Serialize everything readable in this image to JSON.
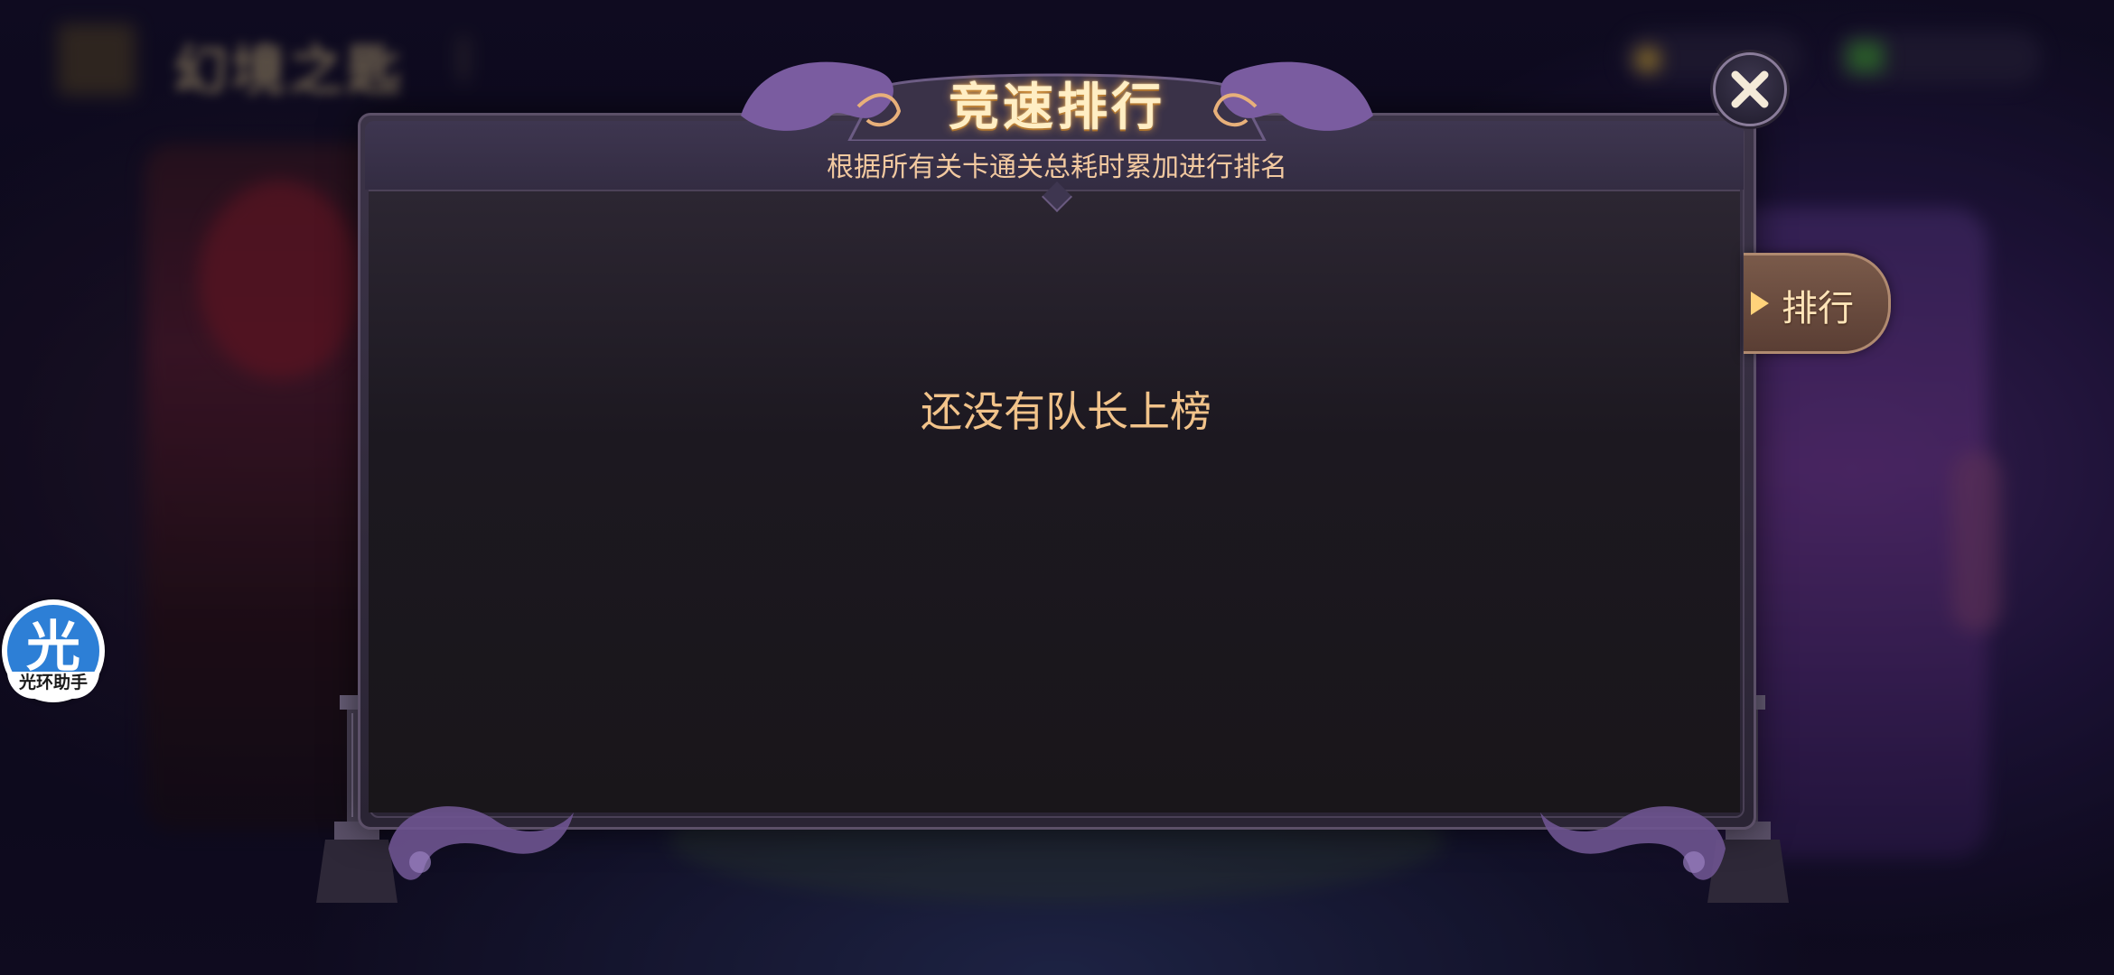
{
  "background": {
    "header_title": "幻境之匙"
  },
  "modal": {
    "title": "竞速排行",
    "subtitle": "根据所有关卡通关总耗时累加进行排名",
    "empty_message": "还没有队长上榜"
  },
  "rank_tab": {
    "label": "排行",
    "icon": "play-arrow-icon"
  },
  "close_button": {
    "icon": "close-icon"
  },
  "assistant": {
    "glyph": "光",
    "label": "光环助手",
    "color": "#2d7fd6"
  },
  "colors": {
    "title_glow": "#e0a04a",
    "message_text": "#f1c38a",
    "frame": "#3c3448",
    "tentacle": "#8a6aac"
  }
}
